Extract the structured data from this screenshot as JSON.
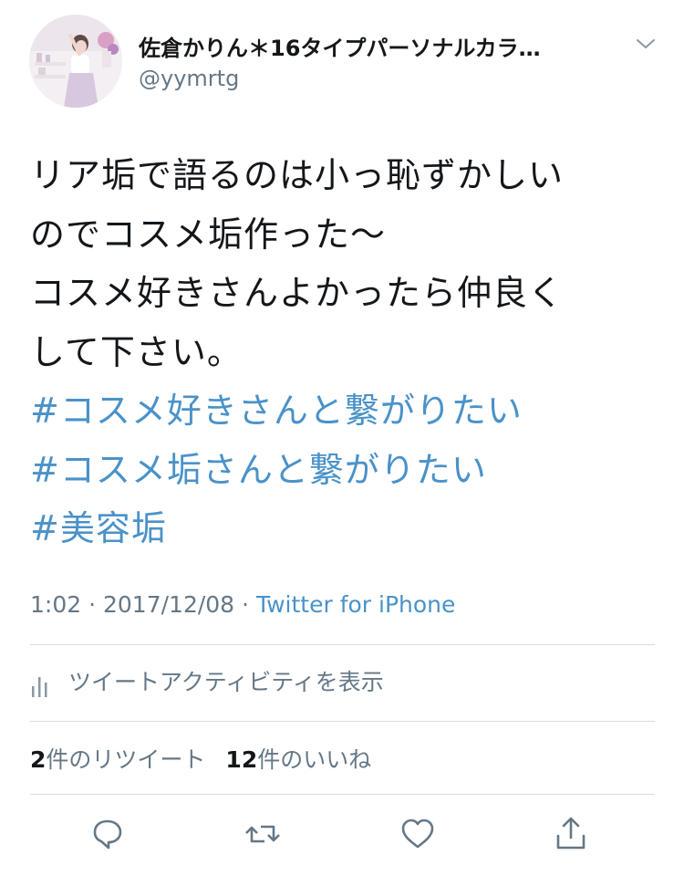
{
  "user": {
    "display_name": "佐倉かりん＊16タイプパーソナルカラ…",
    "handle": "@yymrtg",
    "avatar_icon": "profile-photo"
  },
  "tweet": {
    "text_lines": [
      "リア垢で語るのは小っ恥ずかしい",
      "のでコスメ垢作った〜",
      "コスメ好きさんよかったら仲良く",
      "して下さい。"
    ],
    "hashtags": [
      "#コスメ好きさんと繋がりたい",
      "#コスメ垢さんと繋がりたい",
      "#美容垢"
    ],
    "time": "1:02",
    "date": "2017/12/08",
    "separator": "·",
    "source": "Twitter for iPhone"
  },
  "activity": {
    "label": "ツイートアクティビティを表示",
    "icon": "bar-chart-icon"
  },
  "stats": {
    "retweet_count": "2",
    "retweet_label": "件のリツイート",
    "like_count": "12",
    "like_label": "件のいいね"
  },
  "actions": {
    "reply_icon": "reply-icon",
    "retweet_icon": "retweet-icon",
    "like_icon": "heart-icon",
    "share_icon": "share-icon"
  },
  "colors": {
    "link": "#4a92c9",
    "secondary_text": "#657786",
    "primary_text": "#14171a",
    "divider": "#d8dde2"
  }
}
